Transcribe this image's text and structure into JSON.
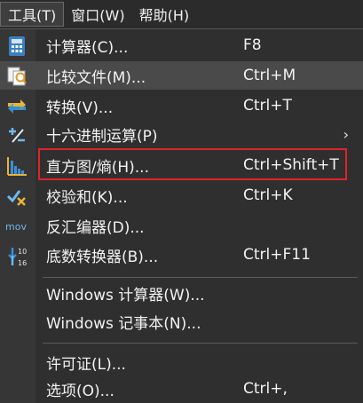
{
  "menubar": {
    "items": [
      {
        "label": "工具(T)",
        "active": true
      },
      {
        "label": "窗口(W)",
        "active": false
      },
      {
        "label": "帮助(H)",
        "active": false
      }
    ]
  },
  "menu": {
    "items": [
      {
        "label": "计算器(C)...",
        "shortcut": "F8",
        "icon": "calculator-icon"
      },
      {
        "label": "比较文件(M)...",
        "shortcut": "Ctrl+M",
        "icon": "compare-files-icon"
      },
      {
        "label": "转换(V)...",
        "shortcut": "Ctrl+T",
        "icon": "convert-icon"
      },
      {
        "label": "十六进制运算(P)",
        "shortcut": "",
        "icon": "hex-operations-icon",
        "submenu_arrow": "›"
      },
      {
        "label": "直方图/熵(H)...",
        "shortcut": "Ctrl+Shift+T",
        "icon": "histogram-icon"
      },
      {
        "label": "校验和(K)...",
        "shortcut": "Ctrl+K",
        "icon": "checksum-icon"
      },
      {
        "label": "反汇编器(D)...",
        "shortcut": "",
        "icon": "disassembler-icon",
        "icon_text": "mov"
      },
      {
        "label": "底数转换器(B)...",
        "shortcut": "Ctrl+F11",
        "icon": "base-converter-icon",
        "icon_text_top": "10",
        "icon_text_bottom": "16"
      },
      {
        "label": "Windows 计算器(W)...",
        "shortcut": "",
        "icon": ""
      },
      {
        "label": "Windows 记事本(N)...",
        "shortcut": "",
        "icon": ""
      },
      {
        "label": "许可证(L)...",
        "shortcut": "",
        "icon": ""
      },
      {
        "label": "选项(O)...",
        "shortcut": "Ctrl+,",
        "icon": ""
      }
    ]
  },
  "colors": {
    "background": "#2f2f2f",
    "highlight_box": "#e0222a",
    "text": "#f2f2f2"
  }
}
